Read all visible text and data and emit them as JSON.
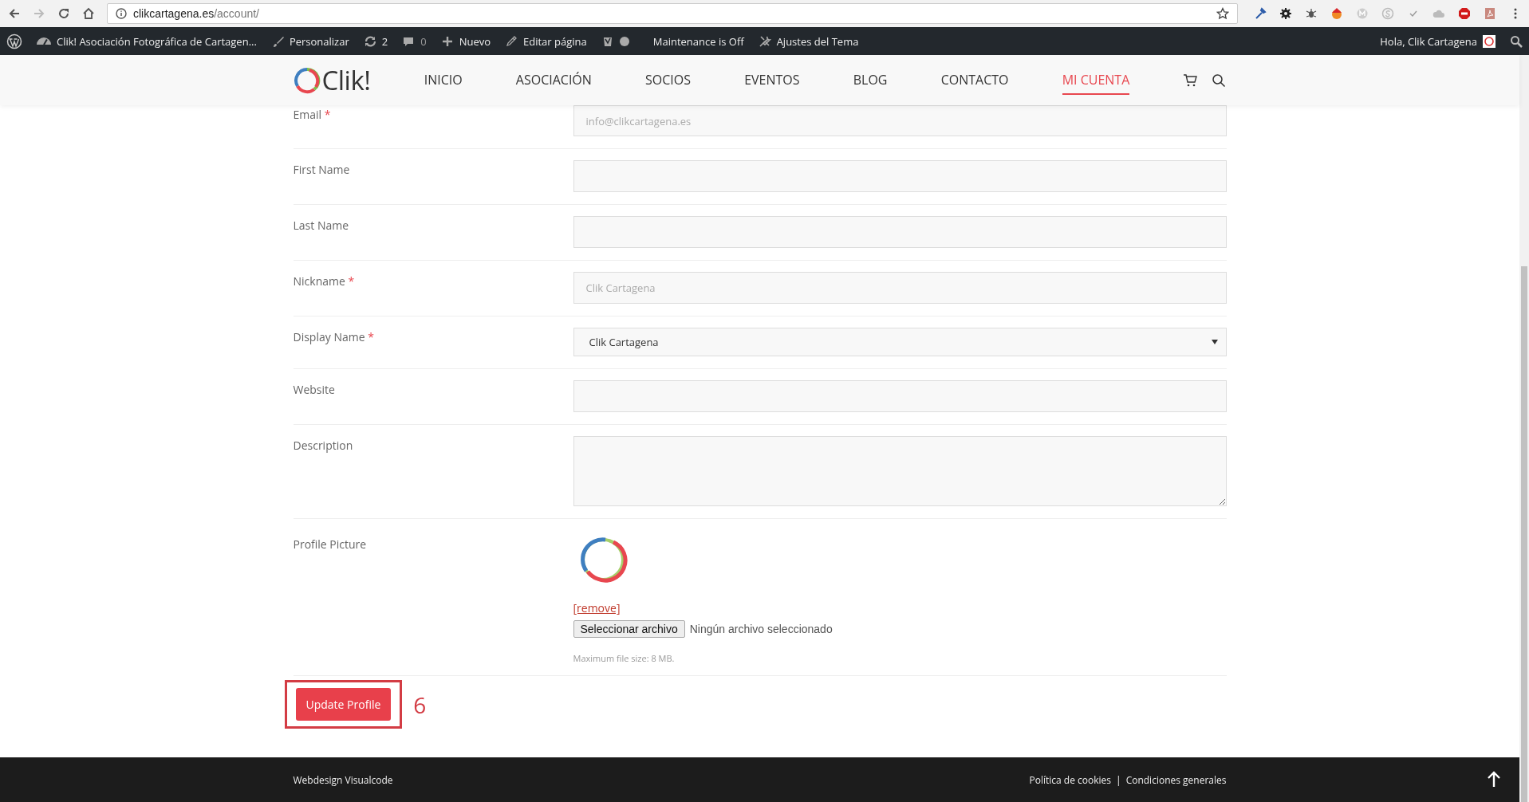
{
  "browser": {
    "url_host": "clikcartagena.es",
    "url_path": "/account/"
  },
  "admin_bar": {
    "items": [
      {
        "kind": "site",
        "label": "Clik! Asociación Fotográfica de Cartagen..."
      },
      {
        "kind": "customize",
        "label": "Personalizar"
      },
      {
        "kind": "updates",
        "label": "2"
      },
      {
        "kind": "comments",
        "label": "0"
      },
      {
        "kind": "new",
        "label": "Nuevo"
      },
      {
        "kind": "edit",
        "label": "Editar página"
      },
      {
        "kind": "seo"
      },
      {
        "kind": "text",
        "label": "Maintenance is Off"
      },
      {
        "kind": "theme",
        "label": "Ajustes del Tema"
      }
    ],
    "greeting": "Hola, Clik Cartagena"
  },
  "nav": {
    "logo": "Clik!",
    "items": [
      {
        "label": "INICIO",
        "selected": false
      },
      {
        "label": "ASOCIACIÓN",
        "selected": false
      },
      {
        "label": "SOCIOS",
        "selected": false
      },
      {
        "label": "EVENTOS",
        "selected": false
      },
      {
        "label": "BLOG",
        "selected": false
      },
      {
        "label": "CONTACTO",
        "selected": false
      },
      {
        "label": "MI CUENTA",
        "selected": true
      }
    ]
  },
  "form": {
    "fields": [
      {
        "kind": "input",
        "label": "Email",
        "required_mark": "*",
        "placeholder": "info@clikcartagena.es"
      },
      {
        "kind": "input",
        "label": "First Name"
      },
      {
        "kind": "input",
        "label": "Last Name"
      },
      {
        "kind": "input",
        "label": "Nickname",
        "required_mark": "*",
        "placeholder": "Clik Cartagena"
      },
      {
        "kind": "select",
        "label": "Display Name",
        "required_mark": "*",
        "value": "Clik Cartagena"
      },
      {
        "kind": "input",
        "label": "Website"
      },
      {
        "kind": "textarea",
        "label": "Description"
      },
      {
        "kind": "picture",
        "label": "Profile Picture",
        "remove": "[remove]",
        "file_button": "Seleccionar archivo",
        "file_status": "Ningún archivo seleccionado",
        "hint": "Maximum file size: 8 MB."
      }
    ],
    "submit": "Update Profile",
    "annotation": "6"
  },
  "footer": {
    "left": "Webdesign Visualcode",
    "links": [
      "Política de cookies",
      "Condiciones generales"
    ],
    "separator": "|"
  }
}
